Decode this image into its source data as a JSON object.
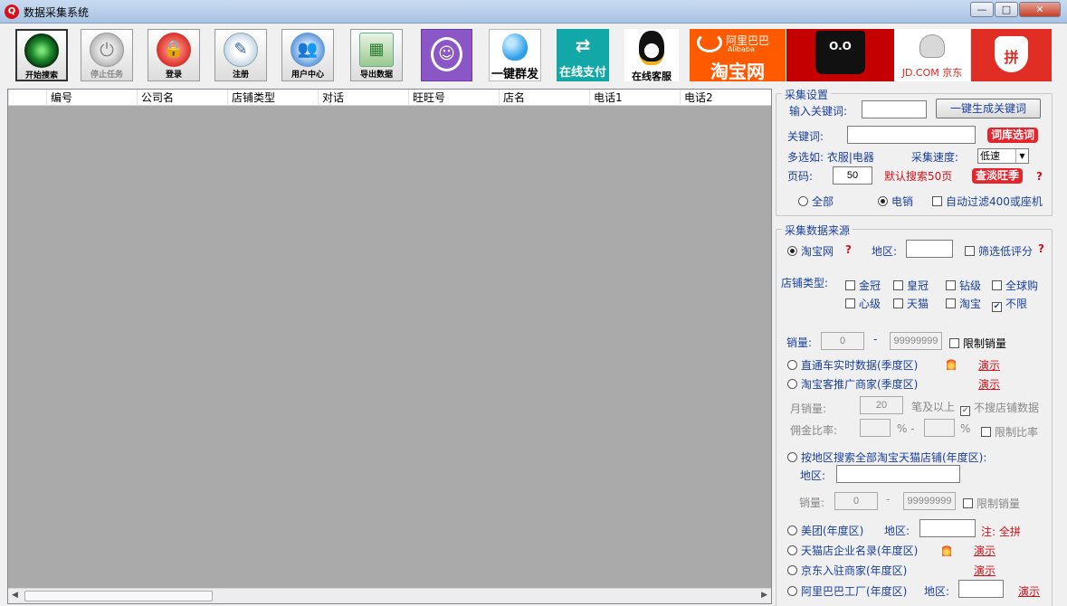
{
  "window": {
    "title": "数据采集系统",
    "controls": [
      "—",
      "□",
      "✕"
    ]
  },
  "toolbar": {
    "start_search": "开始搜索",
    "stop_task": "停止任务",
    "login": "登录",
    "register": "注册",
    "user_center": "用户中心",
    "export_data": "导出数据",
    "broadcast": "一键群发",
    "online_pay": "在线支付",
    "online_service": "在线客服",
    "alibaba_brand": "阿里巴巴",
    "alibaba_latin": "Alibaba",
    "taobao": "淘宝网",
    "jd": "JD.COM 京东",
    "tmall_face": "O.O",
    "pdd": "拼"
  },
  "list": {
    "columns": [
      "编号",
      "公司名",
      "店铺类型",
      "对话",
      "旺旺号",
      "店名",
      "电话1",
      "电话2"
    ]
  },
  "settings": {
    "legend": "采集设置",
    "input_keyword_label": "输入关键词:",
    "input_keyword_value": "",
    "generate_button": "一键生成关键词",
    "keyword_label": "关键词:",
    "keyword_value": "",
    "lexicon_button": "词库选词",
    "multi_hint": "多选如: 衣服|电器",
    "speed_label": "采集速度:",
    "speed_value": "低速",
    "page_label": "页码:",
    "page_value": "50",
    "default_pages": "默认搜索50页",
    "season_button": "查淡旺季",
    "question": "?",
    "mode_all": "全部",
    "mode_mobile": "电销",
    "filter_400": "自动过滤400或座机"
  },
  "source": {
    "legend": "采集数据来源",
    "taobao": "淘宝网",
    "region_label": "地区:",
    "region_value": "",
    "low_score": "筛选低评分",
    "shop_type_label": "店铺类型:",
    "shop_types": [
      "金冠",
      "皇冠",
      "钻级",
      "全球购",
      "心级",
      "天猫",
      "淘宝",
      "不限"
    ],
    "sales_label": "销量:",
    "sales_min": "0",
    "sales_dash": "-",
    "sales_max": "99999999",
    "limit_sales": "限制销量",
    "ztc": "直通车实时数据(季度区)",
    "demo": "演示",
    "taoke": "淘宝客推广商家(季度区)",
    "monthly_label": "月销量:",
    "monthly_value": "20",
    "monthly_suffix": "笔及以上",
    "no_shop_data": "不搜店铺数据",
    "commission_label": "佣金比率:",
    "percent": "%",
    "percent_dash": "% -",
    "limit_rate": "限制比率",
    "by_region": "按地区搜索全部淘宝天猫店铺(年度区):",
    "region2_label": "地区:",
    "region2_value": "",
    "sales2_label": "销量:",
    "sales2_min": "0",
    "sales2_max": "99999999",
    "limit_sales2": "限制销量",
    "meituan": "美团(年度区)",
    "meituan_region": "地区:",
    "meituan_note": "注: 全拼",
    "tmall_enterprise": "天猫店企业名录(年度区)",
    "jd_merchants": "京东入驻商家(年度区)",
    "alibaba_factory": "阿里巴巴工厂(年度区)",
    "factory_region": "地区:"
  }
}
